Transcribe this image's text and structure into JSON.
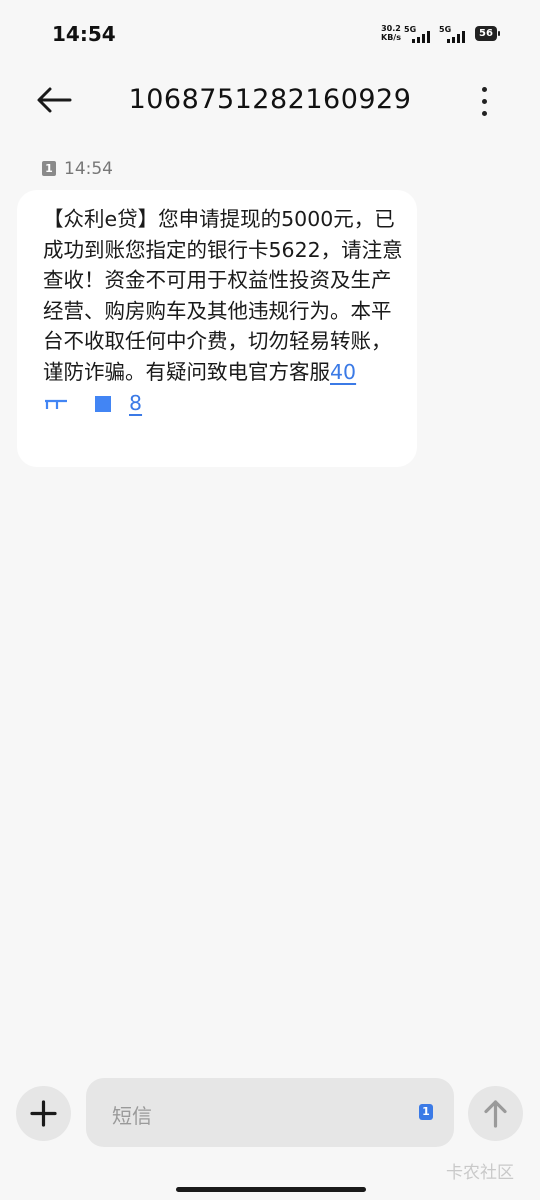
{
  "status_bar": {
    "time": "14:54",
    "net_speed_value": "30.2",
    "net_speed_unit": "KB/s",
    "signal1_label": "5G",
    "signal2_label": "5G",
    "battery": "56"
  },
  "header": {
    "back_icon": "arrow-left-icon",
    "title": "1068751282160929",
    "more_icon": "more-vertical-icon"
  },
  "message": {
    "sim_slot": "1",
    "time": "14:54",
    "body": "【众利e贷】您申请提现的5000元，已成功到账您指定的银行卡5622，请注意查收！资金不可用于权益性投资及生产经营、购房购车及其他违规行为。本平台不收取任何中介费，切勿轻易转账，谨防诈骗。有疑问致电官方客服",
    "phone_prefix": "40",
    "phone_suffix": "8"
  },
  "input": {
    "add_icon": "plus-icon",
    "placeholder": "短信",
    "sim_slot": "1",
    "send_icon": "arrow-up-icon"
  },
  "watermark": "卡农社区"
}
